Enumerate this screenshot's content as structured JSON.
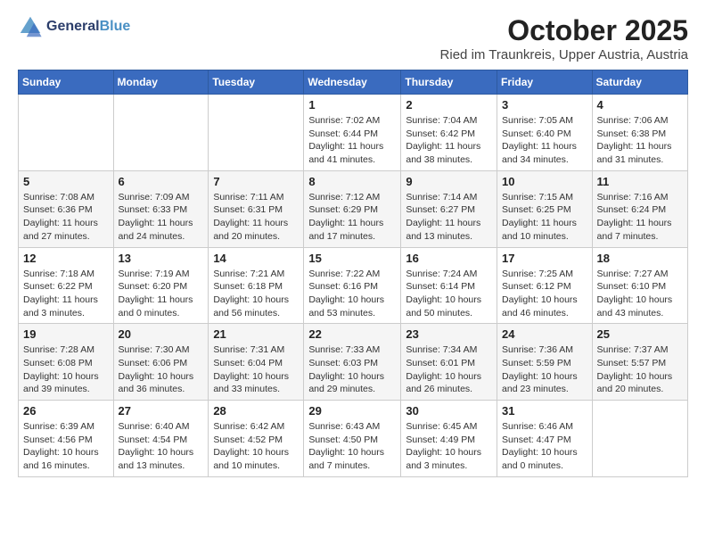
{
  "header": {
    "logo": {
      "line1": "General",
      "line2": "Blue"
    },
    "month": "October 2025",
    "location": "Ried im Traunkreis, Upper Austria, Austria"
  },
  "days_of_week": [
    "Sunday",
    "Monday",
    "Tuesday",
    "Wednesday",
    "Thursday",
    "Friday",
    "Saturday"
  ],
  "weeks": [
    [
      {
        "day": "",
        "info": ""
      },
      {
        "day": "",
        "info": ""
      },
      {
        "day": "",
        "info": ""
      },
      {
        "day": "1",
        "info": "Sunrise: 7:02 AM\nSunset: 6:44 PM\nDaylight: 11 hours and 41 minutes."
      },
      {
        "day": "2",
        "info": "Sunrise: 7:04 AM\nSunset: 6:42 PM\nDaylight: 11 hours and 38 minutes."
      },
      {
        "day": "3",
        "info": "Sunrise: 7:05 AM\nSunset: 6:40 PM\nDaylight: 11 hours and 34 minutes."
      },
      {
        "day": "4",
        "info": "Sunrise: 7:06 AM\nSunset: 6:38 PM\nDaylight: 11 hours and 31 minutes."
      }
    ],
    [
      {
        "day": "5",
        "info": "Sunrise: 7:08 AM\nSunset: 6:36 PM\nDaylight: 11 hours and 27 minutes."
      },
      {
        "day": "6",
        "info": "Sunrise: 7:09 AM\nSunset: 6:33 PM\nDaylight: 11 hours and 24 minutes."
      },
      {
        "day": "7",
        "info": "Sunrise: 7:11 AM\nSunset: 6:31 PM\nDaylight: 11 hours and 20 minutes."
      },
      {
        "day": "8",
        "info": "Sunrise: 7:12 AM\nSunset: 6:29 PM\nDaylight: 11 hours and 17 minutes."
      },
      {
        "day": "9",
        "info": "Sunrise: 7:14 AM\nSunset: 6:27 PM\nDaylight: 11 hours and 13 minutes."
      },
      {
        "day": "10",
        "info": "Sunrise: 7:15 AM\nSunset: 6:25 PM\nDaylight: 11 hours and 10 minutes."
      },
      {
        "day": "11",
        "info": "Sunrise: 7:16 AM\nSunset: 6:24 PM\nDaylight: 11 hours and 7 minutes."
      }
    ],
    [
      {
        "day": "12",
        "info": "Sunrise: 7:18 AM\nSunset: 6:22 PM\nDaylight: 11 hours and 3 minutes."
      },
      {
        "day": "13",
        "info": "Sunrise: 7:19 AM\nSunset: 6:20 PM\nDaylight: 11 hours and 0 minutes."
      },
      {
        "day": "14",
        "info": "Sunrise: 7:21 AM\nSunset: 6:18 PM\nDaylight: 10 hours and 56 minutes."
      },
      {
        "day": "15",
        "info": "Sunrise: 7:22 AM\nSunset: 6:16 PM\nDaylight: 10 hours and 53 minutes."
      },
      {
        "day": "16",
        "info": "Sunrise: 7:24 AM\nSunset: 6:14 PM\nDaylight: 10 hours and 50 minutes."
      },
      {
        "day": "17",
        "info": "Sunrise: 7:25 AM\nSunset: 6:12 PM\nDaylight: 10 hours and 46 minutes."
      },
      {
        "day": "18",
        "info": "Sunrise: 7:27 AM\nSunset: 6:10 PM\nDaylight: 10 hours and 43 minutes."
      }
    ],
    [
      {
        "day": "19",
        "info": "Sunrise: 7:28 AM\nSunset: 6:08 PM\nDaylight: 10 hours and 39 minutes."
      },
      {
        "day": "20",
        "info": "Sunrise: 7:30 AM\nSunset: 6:06 PM\nDaylight: 10 hours and 36 minutes."
      },
      {
        "day": "21",
        "info": "Sunrise: 7:31 AM\nSunset: 6:04 PM\nDaylight: 10 hours and 33 minutes."
      },
      {
        "day": "22",
        "info": "Sunrise: 7:33 AM\nSunset: 6:03 PM\nDaylight: 10 hours and 29 minutes."
      },
      {
        "day": "23",
        "info": "Sunrise: 7:34 AM\nSunset: 6:01 PM\nDaylight: 10 hours and 26 minutes."
      },
      {
        "day": "24",
        "info": "Sunrise: 7:36 AM\nSunset: 5:59 PM\nDaylight: 10 hours and 23 minutes."
      },
      {
        "day": "25",
        "info": "Sunrise: 7:37 AM\nSunset: 5:57 PM\nDaylight: 10 hours and 20 minutes."
      }
    ],
    [
      {
        "day": "26",
        "info": "Sunrise: 6:39 AM\nSunset: 4:56 PM\nDaylight: 10 hours and 16 minutes."
      },
      {
        "day": "27",
        "info": "Sunrise: 6:40 AM\nSunset: 4:54 PM\nDaylight: 10 hours and 13 minutes."
      },
      {
        "day": "28",
        "info": "Sunrise: 6:42 AM\nSunset: 4:52 PM\nDaylight: 10 hours and 10 minutes."
      },
      {
        "day": "29",
        "info": "Sunrise: 6:43 AM\nSunset: 4:50 PM\nDaylight: 10 hours and 7 minutes."
      },
      {
        "day": "30",
        "info": "Sunrise: 6:45 AM\nSunset: 4:49 PM\nDaylight: 10 hours and 3 minutes."
      },
      {
        "day": "31",
        "info": "Sunrise: 6:46 AM\nSunset: 4:47 PM\nDaylight: 10 hours and 0 minutes."
      },
      {
        "day": "",
        "info": ""
      }
    ]
  ]
}
